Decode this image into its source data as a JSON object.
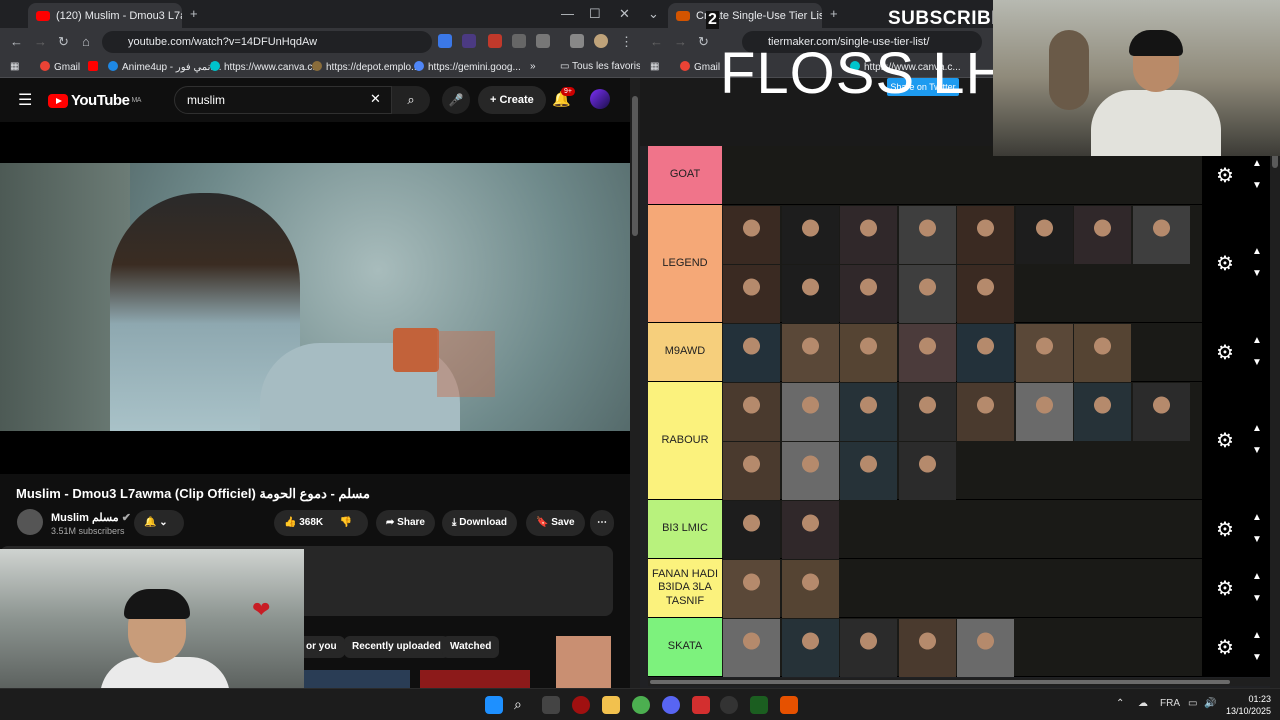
{
  "left_browser": {
    "tab_title": "(120) Muslim - Dmou3 L7a",
    "url": "youtube.com/watch?v=14DFUnHqdAw",
    "bookmarks": [
      "Gmail",
      "Anime4up - انمي فور...",
      "https://www.canva.c...",
      "https://depot.emplo...",
      "https://gemini.goog...",
      "Tous les favoris"
    ]
  },
  "youtube": {
    "logo_text": "YouTube",
    "region": "MA",
    "search_value": "muslim",
    "create_label": "Create",
    "notif_count": "9+",
    "video_title": "Muslim - Dmou3 L7awma (Clip Officiel) مسلم - دموع الحومة",
    "channel_name": "Muslim مسلم",
    "subscribers": "3.51M subscribers",
    "likes": "368K",
    "share_label": "Share",
    "download_label": "Download",
    "save_label": "Save",
    "chips": [
      "or you",
      "Recently uploaded",
      "Watched"
    ]
  },
  "right_browser": {
    "tab_title": "Create Single-Use Tier List (P",
    "url": "tiermaker.com/single-use-tier-list/",
    "bookmarks": [
      "Gmail",
      "https://www.canva.c..."
    ],
    "share_button": "Share on Twitter"
  },
  "stream_overlay": {
    "subscribe": "SUBSCRIBE",
    "big_text": "FLOSS LHS",
    "number": "2"
  },
  "tiers": [
    {
      "label": "GOAT",
      "color": "#f0748a",
      "count": 0
    },
    {
      "label": "LEGEND",
      "color": "#f5a877",
      "count": 13
    },
    {
      "label": "M9AWD",
      "color": "#f6cf7c",
      "count": 7
    },
    {
      "label": "RABOUR",
      "color": "#fbf27d",
      "count": 12
    },
    {
      "label": "BI3 LMIC",
      "color": "#b8f27d",
      "count": 2
    },
    {
      "label": "FANAN HADI B3IDA 3LA TASNIF",
      "color": "#fbf27d",
      "count": 2
    },
    {
      "label": "SKATA",
      "color": "#7df27d",
      "count": 5
    }
  ],
  "taskbar": {
    "lang": "FRA",
    "time": "01:23",
    "date": "13/10/2025"
  }
}
